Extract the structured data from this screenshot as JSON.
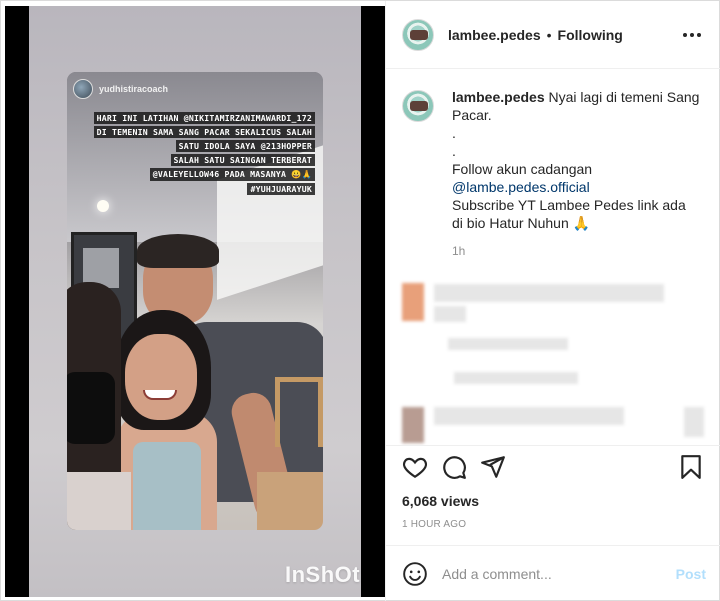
{
  "media": {
    "story_username": "yudhistiracoach",
    "story_caption_lines": [
      "HARI INI LATIHAN @NIKITAMIRZANIMAWARDI_172",
      "DI TEMENIN SAMA SANG PACAR SEKALICUS SALAH",
      "SATU IDOLA SAYA @213HOPPER",
      "SALAH SATU SAINGAN TERBERAT",
      "@VALEYELLOW46 PADA MASANYA 😀🙏",
      "#YUHJUARAYUK"
    ],
    "watermark": "InShOt"
  },
  "header": {
    "username": "lambee.pedes",
    "separator": "•",
    "follow_status": "Following",
    "more_icon": "more-horizontal-icon"
  },
  "caption": {
    "username": "lambee.pedes",
    "text": "Nyai lagi di temeni Sang Pacar.",
    "dot1": ".",
    "dot2": ".",
    "line1": "Follow akun cadangan",
    "mention": "@lambe.pedes.official",
    "line2": "Subscribe YT Lambee Pedes link ada di bio Hatur Nuhun 🙏",
    "time": "1h"
  },
  "actions": {
    "like_icon": "heart-icon",
    "comment_icon": "comment-icon",
    "share_icon": "send-icon",
    "save_icon": "bookmark-icon"
  },
  "stats": {
    "views": "6,068 views",
    "posted": "1 HOUR AGO"
  },
  "comment_box": {
    "emoji_icon": "emoji-icon",
    "placeholder": "Add a comment...",
    "post_label": "Post"
  },
  "colors": {
    "link": "#00376b",
    "muted": "#8e8e8e",
    "post_disabled": "#b2dffc"
  }
}
